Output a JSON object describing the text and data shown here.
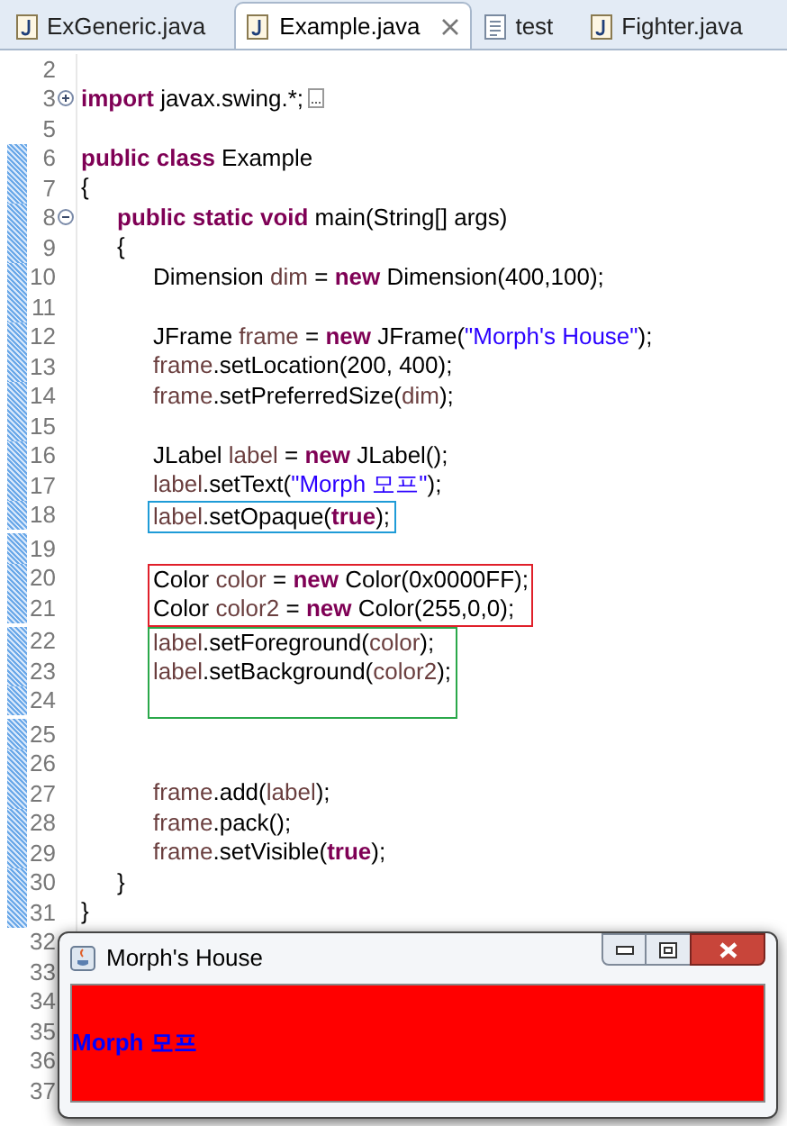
{
  "tabs": [
    {
      "label": "ExGeneric.java",
      "kind": "java",
      "selected": false
    },
    {
      "label": "Example.java",
      "kind": "java",
      "selected": true
    },
    {
      "label": "test",
      "kind": "text",
      "selected": false
    },
    {
      "label": "Fighter.java",
      "kind": "java",
      "selected": false
    }
  ],
  "code": [
    {
      "kind": "line",
      "number": "2",
      "changed": false
    },
    {
      "kind": "line",
      "number": "3",
      "changed": false,
      "foldable": true,
      "collapsed": true,
      "tokens": [
        {
          "kind": "kw",
          "text": "import"
        },
        {
          "kind": "plain",
          "text": " javax.swing.*;"
        }
      ]
    },
    {
      "kind": "line",
      "number": "5",
      "changed": false
    },
    {
      "kind": "line",
      "number": "6",
      "changed": true,
      "tokens": [
        {
          "kind": "kw",
          "text": "public class"
        },
        {
          "kind": "plain",
          "text": " Example"
        }
      ]
    },
    {
      "kind": "line",
      "number": "7",
      "changed": true,
      "tokens": [
        {
          "kind": "plain",
          "text": "{"
        }
      ]
    },
    {
      "kind": "block",
      "children": [
        {
          "kind": "line",
          "number": "8",
          "changed": true,
          "foldable": true,
          "collapsed": false,
          "tokens": [
            {
              "kind": "kw",
              "text": "public static void"
            },
            {
              "kind": "plain",
              "text": " main(String[] args)"
            }
          ]
        },
        {
          "kind": "line",
          "number": "9",
          "changed": true,
          "tokens": [
            {
              "kind": "plain",
              "text": "{"
            }
          ]
        },
        {
          "kind": "block",
          "children": [
            {
              "kind": "line",
              "number": "10",
              "changed": true,
              "tokens": [
                {
                  "kind": "plain",
                  "text": "Dimension "
                },
                {
                  "kind": "var",
                  "text": "dim"
                },
                {
                  "kind": "plain",
                  "text": " = "
                },
                {
                  "kind": "kw",
                  "text": "new"
                },
                {
                  "kind": "plain",
                  "text": " Dimension(400,100);"
                }
              ]
            },
            {
              "kind": "line",
              "number": "11",
              "changed": true
            },
            {
              "kind": "line",
              "number": "12",
              "changed": true,
              "tokens": [
                {
                  "kind": "plain",
                  "text": "JFrame "
                },
                {
                  "kind": "var",
                  "text": "frame"
                },
                {
                  "kind": "plain",
                  "text": " = "
                },
                {
                  "kind": "kw",
                  "text": "new"
                },
                {
                  "kind": "plain",
                  "text": " JFrame("
                },
                {
                  "kind": "string",
                  "text": "\"Morph's House\""
                },
                {
                  "kind": "plain",
                  "text": ");"
                }
              ]
            },
            {
              "kind": "line",
              "number": "13",
              "changed": true,
              "tokens": [
                {
                  "kind": "var",
                  "text": "frame"
                },
                {
                  "kind": "plain",
                  "text": ".setLocation(200, 400);"
                }
              ]
            },
            {
              "kind": "line",
              "number": "14",
              "changed": true,
              "tokens": [
                {
                  "kind": "var",
                  "text": "frame"
                },
                {
                  "kind": "plain",
                  "text": ".setPreferredSize("
                },
                {
                  "kind": "var",
                  "text": "dim"
                },
                {
                  "kind": "plain",
                  "text": ");"
                }
              ]
            },
            {
              "kind": "line",
              "number": "15",
              "changed": true
            },
            {
              "kind": "line",
              "number": "16",
              "changed": true,
              "tokens": [
                {
                  "kind": "plain",
                  "text": "JLabel "
                },
                {
                  "kind": "var",
                  "text": "label"
                },
                {
                  "kind": "plain",
                  "text": " = "
                },
                {
                  "kind": "kw",
                  "text": "new"
                },
                {
                  "kind": "plain",
                  "text": " JLabel();"
                }
              ]
            },
            {
              "kind": "line",
              "number": "17",
              "changed": true,
              "tokens": [
                {
                  "kind": "var",
                  "text": "label"
                },
                {
                  "kind": "plain",
                  "text": ".setText("
                },
                {
                  "kind": "string",
                  "text": "\"Morph 모프\""
                },
                {
                  "kind": "plain",
                  "text": ");"
                }
              ]
            },
            {
              "kind": "boxed",
              "color": "#1e9bd7",
              "lines": [
                {
                  "number": "18",
                  "changed": true,
                  "tokens": [
                    {
                      "kind": "var",
                      "text": "label"
                    },
                    {
                      "kind": "plain",
                      "text": ".setOpaque("
                    },
                    {
                      "kind": "kw",
                      "text": "true"
                    },
                    {
                      "kind": "plain",
                      "text": ");"
                    }
                  ]
                }
              ]
            },
            {
              "kind": "line",
              "number": "19",
              "changed": true
            },
            {
              "kind": "boxed",
              "color": "#e0202a",
              "lines": [
                {
                  "number": "20",
                  "changed": true,
                  "tokens": [
                    {
                      "kind": "plain",
                      "text": "Color "
                    },
                    {
                      "kind": "var",
                      "text": "color"
                    },
                    {
                      "kind": "plain",
                      "text": " = "
                    },
                    {
                      "kind": "kw",
                      "text": "new"
                    },
                    {
                      "kind": "plain",
                      "text": " Color(0x0000FF);"
                    }
                  ]
                },
                {
                  "number": "21",
                  "changed": true,
                  "tokens": [
                    {
                      "kind": "plain",
                      "text": "Color "
                    },
                    {
                      "kind": "var",
                      "text": "color2"
                    },
                    {
                      "kind": "plain",
                      "text": " = "
                    },
                    {
                      "kind": "kw",
                      "text": "new"
                    },
                    {
                      "kind": "plain",
                      "text": " Color(255,0,0);"
                    }
                  ]
                }
              ]
            },
            {
              "kind": "boxed",
              "color": "#2aa84a",
              "lines": [
                {
                  "number": "22",
                  "changed": true,
                  "tokens": [
                    {
                      "kind": "var",
                      "text": "label"
                    },
                    {
                      "kind": "plain",
                      "text": ".setForeground("
                    },
                    {
                      "kind": "var",
                      "text": "color"
                    },
                    {
                      "kind": "plain",
                      "text": ");"
                    }
                  ]
                },
                {
                  "number": "23",
                  "changed": true,
                  "tokens": [
                    {
                      "kind": "var",
                      "text": "label"
                    },
                    {
                      "kind": "plain",
                      "text": ".setBackground("
                    },
                    {
                      "kind": "var",
                      "text": "color2"
                    },
                    {
                      "kind": "plain",
                      "text": ");"
                    }
                  ]
                },
                {
                  "number": "24",
                  "changed": true
                }
              ]
            },
            {
              "kind": "line",
              "number": "25",
              "changed": true
            },
            {
              "kind": "line",
              "number": "26",
              "changed": true
            },
            {
              "kind": "line",
              "number": "27",
              "changed": true,
              "tokens": [
                {
                  "kind": "var",
                  "text": "frame"
                },
                {
                  "kind": "plain",
                  "text": ".add("
                },
                {
                  "kind": "var",
                  "text": "label"
                },
                {
                  "kind": "plain",
                  "text": ");"
                }
              ]
            },
            {
              "kind": "line",
              "number": "28",
              "changed": true,
              "tokens": [
                {
                  "kind": "var",
                  "text": "frame"
                },
                {
                  "kind": "plain",
                  "text": ".pack();"
                }
              ]
            },
            {
              "kind": "line",
              "number": "29",
              "changed": true,
              "tokens": [
                {
                  "kind": "var",
                  "text": "frame"
                },
                {
                  "kind": "plain",
                  "text": ".setVisible("
                },
                {
                  "kind": "kw",
                  "text": "true"
                },
                {
                  "kind": "plain",
                  "text": ");"
                }
              ]
            }
          ]
        },
        {
          "kind": "line",
          "number": "30",
          "changed": true,
          "tokens": [
            {
              "kind": "plain",
              "text": "}"
            }
          ]
        }
      ]
    },
    {
      "kind": "line",
      "number": "31",
      "changed": true,
      "tokens": [
        {
          "kind": "plain",
          "text": "}"
        }
      ]
    },
    {
      "kind": "line",
      "number": "32",
      "changed": false
    },
    {
      "kind": "line",
      "number": "33",
      "changed": false
    },
    {
      "kind": "line",
      "number": "34",
      "changed": false
    },
    {
      "kind": "line",
      "number": "35",
      "changed": false
    },
    {
      "kind": "line",
      "number": "36",
      "changed": false
    },
    {
      "kind": "line",
      "number": "37",
      "changed": false
    }
  ],
  "frame_window": {
    "title": "Morph's House",
    "label": "Morph 모프"
  }
}
